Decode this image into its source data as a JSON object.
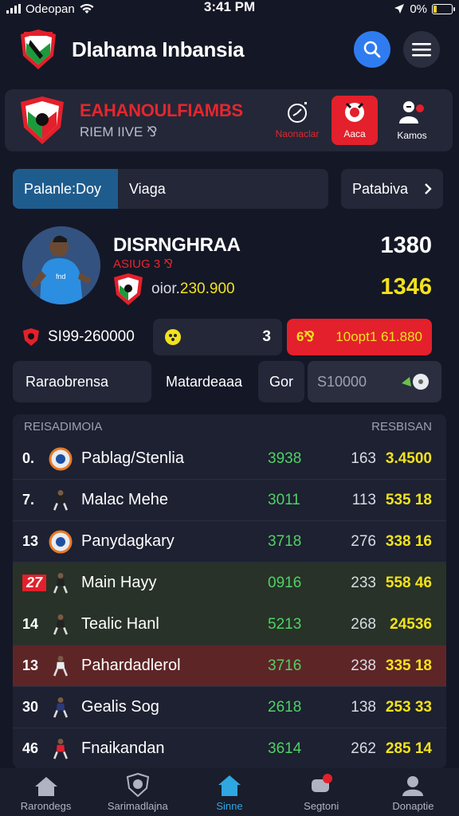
{
  "status_bar": {
    "carrier": "Odeopan",
    "time": "3:41 PM",
    "battery": "0%",
    "battery_level": 0.2
  },
  "header": {
    "title": "Dlahama Inbansia",
    "search_icon": "search-icon",
    "menu_icon": "hamburger-menu-icon"
  },
  "banner": {
    "team_name": "EAHANOULFIAMBS",
    "subtitle": "RIEM IIVE ⅋",
    "actions": [
      {
        "label": "Naonaclar",
        "icon": "stopwatch-icon"
      },
      {
        "label": "Aaca",
        "icon": "live-camera-icon"
      },
      {
        "label": "Kamos",
        "icon": "team-users-icon"
      }
    ]
  },
  "filters": {
    "active": "Palanle:Doy",
    "second": "Viaga",
    "third": "Patabiva"
  },
  "player": {
    "name": "DISRNGHRAA",
    "sub": "ASIUG 3 ⅋",
    "value_prefix": "oior.",
    "value_amount": "230.900",
    "stat_top": "1380",
    "stat_bottom": "1346"
  },
  "stats": {
    "a": "SI99-260000",
    "b": "3",
    "c_label": "6⅋",
    "c_value": "10opt1 61.880"
  },
  "tabs": [
    "Raraobrensa",
    "Matardeaaa",
    "Gor",
    "S10000"
  ],
  "table": {
    "header_left": "REISADIMOIA",
    "header_right": "RESBISAN",
    "rows": [
      {
        "rank": "0.",
        "name": "Pablag/Stenlia",
        "pts": "3938",
        "n1": "163",
        "n2": "3.4500",
        "style": "normal",
        "icon": "club-crest-icon"
      },
      {
        "rank": "7.",
        "name": "Malac Mehe",
        "pts": "3011",
        "n1": "113",
        "n2": "535 18",
        "style": "normal",
        "icon": "player-figure-icon"
      },
      {
        "rank": "13",
        "name": "Panydagkary",
        "pts": "3718",
        "n1": "276",
        "n2": "338 16",
        "style": "normal",
        "icon": "club-crest-icon"
      },
      {
        "rank": "27",
        "name": "Main Hayy",
        "pts": "0916",
        "n1": "233",
        "n2": "558 46",
        "style": "green",
        "icon": "player-figure-icon"
      },
      {
        "rank": "14",
        "name": "Tealic Hanl",
        "pts": "5213",
        "n1": "268",
        "n2": "24536",
        "style": "green",
        "icon": "player-figure-icon"
      },
      {
        "rank": "13",
        "name": "Pahardadlerol",
        "pts": "3716",
        "n1": "238",
        "n2": "335 18",
        "style": "red",
        "icon": "player-figure-icon"
      },
      {
        "rank": "30",
        "name": "Gealis Sog",
        "pts": "2618",
        "n1": "138",
        "n2": "253 33",
        "style": "normal",
        "icon": "player-figure-icon"
      },
      {
        "rank": "46",
        "name": "Fnaikandan",
        "pts": "3614",
        "n1": "262",
        "n2": "285 14",
        "style": "normal",
        "icon": "player-figure-icon"
      }
    ]
  },
  "bottom_nav": [
    {
      "label": "Rarondegs",
      "icon": "home-icon"
    },
    {
      "label": "Sarimadlajna",
      "icon": "shield-icon"
    },
    {
      "label": "Sinne",
      "icon": "home-icon"
    },
    {
      "label": "Segtoni",
      "icon": "chat-notification-icon"
    },
    {
      "label": "Donaptie",
      "icon": "profile-icon"
    }
  ],
  "colors": {
    "accent_red": "#e3202b",
    "accent_blue": "#2f7cf0",
    "accent_yellow": "#f2e21c",
    "accent_green": "#4fd164",
    "background": "#141726"
  }
}
